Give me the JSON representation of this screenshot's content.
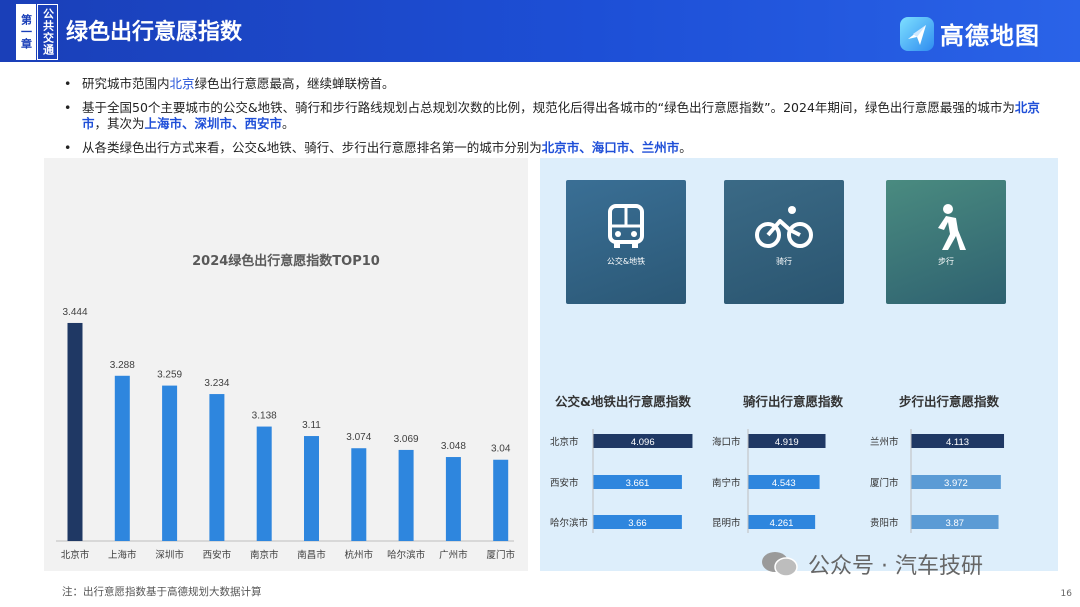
{
  "header": {
    "chapter_num": "第一章",
    "chapter_name": "公共交通",
    "title": "绿色出行意愿指数",
    "brand": "高德地图"
  },
  "bullets": [
    {
      "a": "研究城市范围内",
      "b": "北京",
      "c": "绿色出行意愿最高，继续蝉联榜首。"
    },
    {
      "a": "基于全国50个主要城市的公交&地铁、骑行和步行路线规划占总规划次数的比例，规范化后得出各城市的“绿色出行意愿指数”。2024年期间，绿色出行意愿最强的城市为",
      "b": "北京市",
      "c": "，其次为",
      "d": "上海市、深圳市、西安市",
      "e": "。"
    },
    {
      "a": "从各类绿色出行方式来看，公交&地铁、骑行、步行出行意愿排名第一的城市分别为",
      "b": "北京市、海口市、兰州市",
      "c": "。"
    }
  ],
  "chart_data": [
    {
      "type": "bar",
      "title": "2024绿色出行意愿指数TOP10",
      "categories": [
        "北京市",
        "上海市",
        "深圳市",
        "西安市",
        "南京市",
        "南昌市",
        "杭州市",
        "哈尔滨市",
        "广州市",
        "厦门市"
      ],
      "values": [
        3.444,
        3.288,
        3.259,
        3.234,
        3.138,
        3.11,
        3.074,
        3.069,
        3.048,
        3.04
      ],
      "value_labels": [
        "3.444",
        "3.288",
        "3.259",
        "3.234",
        "3.138",
        "3.11",
        "3.074",
        "3.069",
        "3.048",
        "3.04"
      ],
      "ylim": [
        2.8,
        3.5
      ],
      "colors": {
        "first": "#1f3864",
        "rest": "#2e86de"
      }
    },
    {
      "type": "bar",
      "orientation": "horizontal",
      "title": "公交&地铁出行意愿指数",
      "categories": [
        "北京市",
        "西安市",
        "哈尔滨市"
      ],
      "values": [
        4.096,
        3.661,
        3.66
      ],
      "value_labels": [
        "4.096",
        "3.661",
        "3.66"
      ],
      "xlim": [
        0,
        4.2
      ]
    },
    {
      "type": "bar",
      "orientation": "horizontal",
      "title": "骑行出行意愿指数",
      "categories": [
        "海口市",
        "南宁市",
        "昆明市"
      ],
      "values": [
        4.919,
        4.543,
        4.261
      ],
      "value_labels": [
        "4.919",
        "4.543",
        "4.261"
      ],
      "xlim": [
        0,
        4.95
      ]
    },
    {
      "type": "bar",
      "orientation": "horizontal",
      "title": "步行出行意愿指数",
      "categories": [
        "兰州市",
        "厦门市",
        "贵阳市"
      ],
      "values": [
        4.113,
        3.972,
        3.87
      ],
      "value_labels": [
        "4.113",
        "3.972",
        "3.87"
      ],
      "xlim": [
        0,
        4.2
      ]
    }
  ],
  "modes": [
    {
      "label": "公交&地铁",
      "icon": "bus-icon"
    },
    {
      "label": "骑行",
      "icon": "bicycle-icon"
    },
    {
      "label": "步行",
      "icon": "walking-icon"
    }
  ],
  "colors": {
    "header_blue": "#1a3fb8",
    "highlight_blue": "#1f4fd8",
    "bar_dark": "#1f3864",
    "bar_mid": "#2e86de",
    "bar_light": "#5b9bd5",
    "panel_light_blue": "#ddeefb"
  },
  "footnote": "注：出行意愿指数基于高德规划大数据计算",
  "watermark": "公众号 · 汽车技研",
  "page_number": "16"
}
